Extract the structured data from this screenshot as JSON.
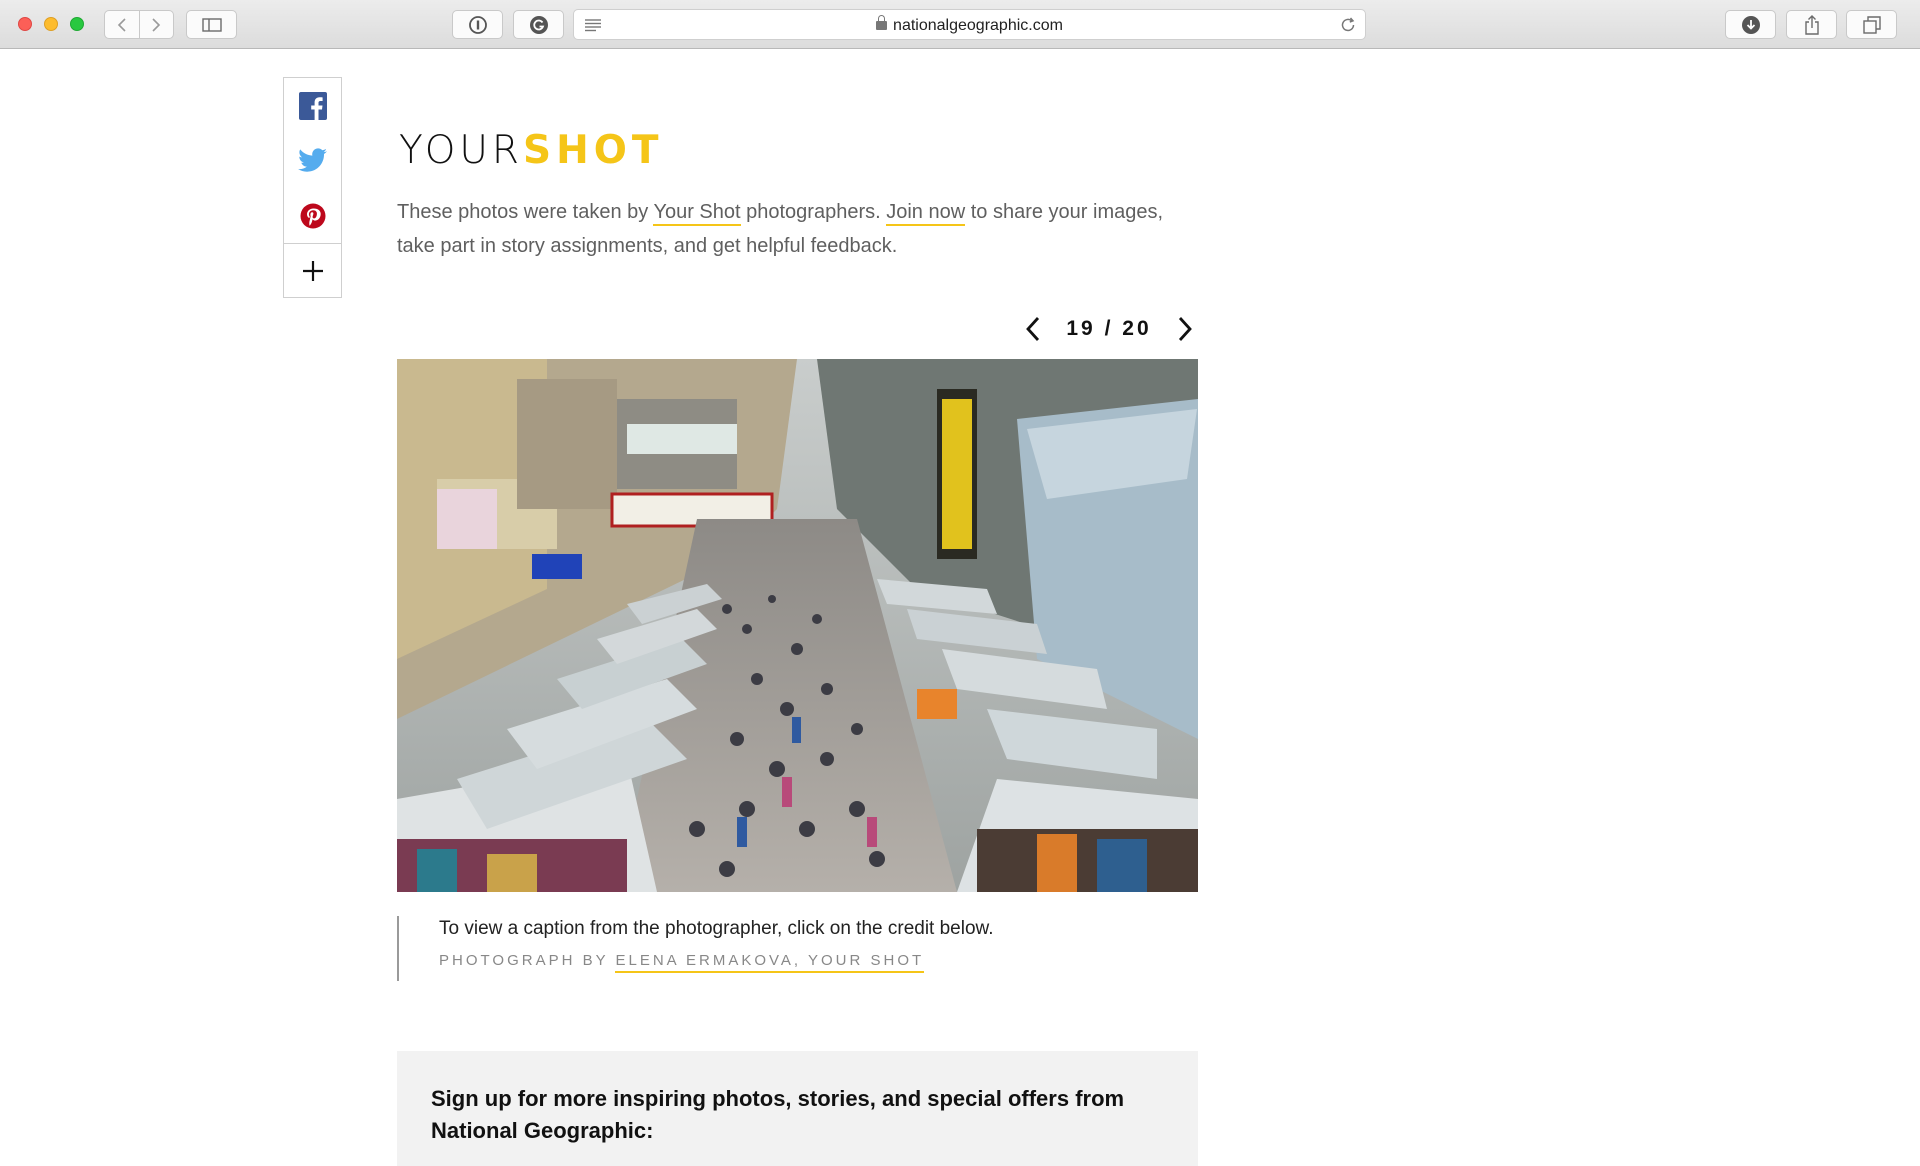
{
  "browser": {
    "url": "nationalgeographic.com"
  },
  "share": {
    "icons": [
      "facebook-icon",
      "twitter-icon",
      "pinterest-icon",
      "plus-icon"
    ],
    "colors": {
      "facebook": "#3b5998",
      "twitter": "#55acee",
      "pinterest": "#bd081c"
    }
  },
  "header": {
    "logo_your": "YOUR",
    "logo_shot": "SHOT",
    "accent": "#f5c518"
  },
  "intro": {
    "part1": "These photos were taken by ",
    "link1": "Your Shot",
    "part2": " photographers. ",
    "link2": "Join now",
    "part3": " to share your images, take part in story assignments, and get helpful feedback."
  },
  "gallery": {
    "current": "19",
    "total": "20",
    "separator": "/",
    "photo_alt": "Crowded street market with stalls and signs"
  },
  "caption": {
    "text": "To view a caption from the photographer, click on the credit below.",
    "credit_prefix": "PHOTOGRAPH BY ",
    "credit_name": "ELENA ERMAKOVA, YOUR SHOT"
  },
  "signup": {
    "heading": "Sign up for more inspiring photos, stories, and special offers from National Geographic:"
  }
}
